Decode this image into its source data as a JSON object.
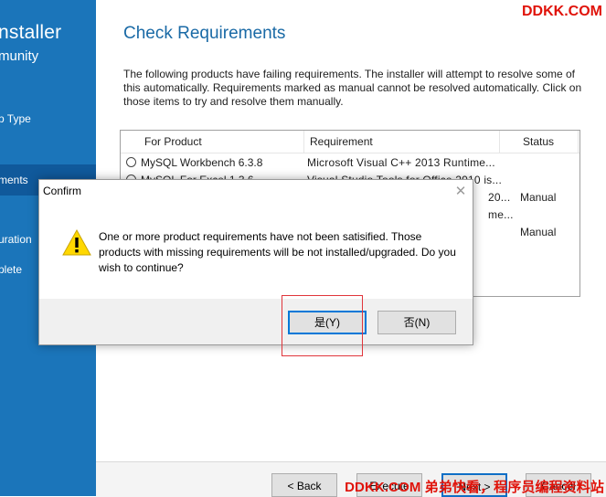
{
  "watermark": {
    "top": "DDKK.COM",
    "bottom": "DDKK.COM 弟弟快看，程序员编程资料站"
  },
  "sidebar": {
    "title": "nstaller",
    "subtitle": "munity",
    "items": [
      {
        "label": "p Type"
      },
      {
        "label": "ments",
        "active": true
      },
      {
        "label": "uration"
      },
      {
        "label": "plete"
      }
    ]
  },
  "main": {
    "title": "Check Requirements",
    "description": "The following products have failing requirements.  The installer will attempt to resolve some of this automatically.  Requirements marked as manual cannot be resolved automatically.  Click on those items to try and  resolve them manually."
  },
  "table": {
    "columns": [
      "For Product",
      "Requirement",
      "Status"
    ],
    "rows": [
      {
        "product": "MySQL Workbench 6.3.8",
        "requirement": "Microsoft Visual C++ 2013 Runtime...",
        "status": ""
      },
      {
        "product": "MySQL For Excel 1.3.6",
        "requirement": "Visual Studio Tools for Office 2010 is...",
        "status": ""
      },
      {
        "product": "",
        "requirement": "20...",
        "status": "Manual"
      },
      {
        "product": "",
        "requirement": "me...",
        "status": ""
      },
      {
        "product": "",
        "requirement": "",
        "status": "Manual"
      }
    ]
  },
  "wizard_buttons": {
    "back": "< Back",
    "execute": "Execute",
    "next": "Next >",
    "cancel": "Cancel"
  },
  "dialog": {
    "title": "Confirm",
    "message": "One or more product requirements have not been satisified. Those products with missing requirements will be not installed/upgraded. Do you wish to continue?",
    "yes_label": "是(Y)",
    "no_label": "否(N)"
  },
  "colors": {
    "sidebar_bg": "#1b75ba",
    "title_blue": "#1a6aa6",
    "warning_yellow": "#ffd800",
    "watermark_red": "#e0130a",
    "highlight_red": "#e0353b"
  }
}
